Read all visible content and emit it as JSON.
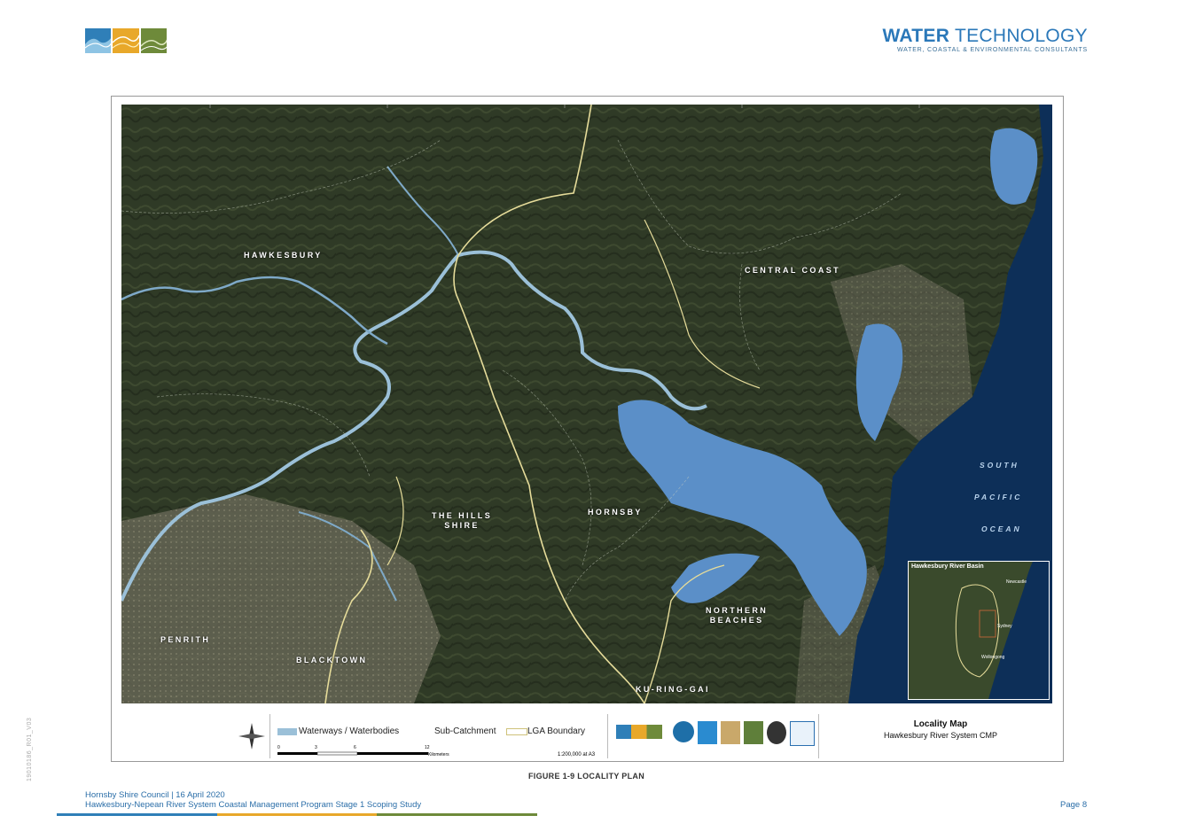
{
  "header": {
    "brand_word_1": "WATER",
    "brand_word_2": " TECHNOLOGY",
    "brand_tagline": "WATER, COASTAL & ENVIRONMENTAL CONSULTANTS"
  },
  "map": {
    "lga_labels": {
      "hawkesbury": "HAWKESBURY",
      "central_coast": "CENTRAL COAST",
      "the_hills_1": "THE HILLS",
      "the_hills_2": "SHIRE",
      "hornsby": "HORNSBY",
      "northern_1": "NORTHERN",
      "northern_2": "BEACHES",
      "penrith": "PENRITH",
      "blacktown": "BLACKTOWN",
      "ku_ring_gai": "KU-RING-GAI"
    },
    "ocean_labels": [
      "SOUTH",
      "PACIFIC",
      "OCEAN"
    ],
    "inset_title": "Hawkesbury River Basin",
    "inset_places": {
      "newcastle": "Newcastle",
      "sydney": "Sydney",
      "wollongong": "Wollongong"
    },
    "colors": {
      "water": "#5b8fc8",
      "river": "#9bc0d8",
      "lga": "#e6dc9a",
      "ocean": "#0d2f58",
      "land": "#2f3a26"
    }
  },
  "legend": {
    "waterways": "Waterways / Waterbodies",
    "subcatchment": "Sub-Catchment",
    "lga": "LGA Boundary",
    "scale_ticks": [
      "0",
      "3",
      "6",
      "12"
    ],
    "scale_unit": "Kilometers",
    "scale_ratio": "1:200,000 at A3",
    "title": "Locality Map",
    "subtitle": "Hawkesbury River System CMP"
  },
  "figure_caption": "FIGURE 1-9   LOCALITY PLAN",
  "footer": {
    "line1": "Hornsby Shire Council | 16 April 2020",
    "line2": "Hawkesbury-Nepean River System Coastal Management Program Stage 1 Scoping Study",
    "page": "Page 8"
  },
  "side_code": "19010186_R01_V03"
}
